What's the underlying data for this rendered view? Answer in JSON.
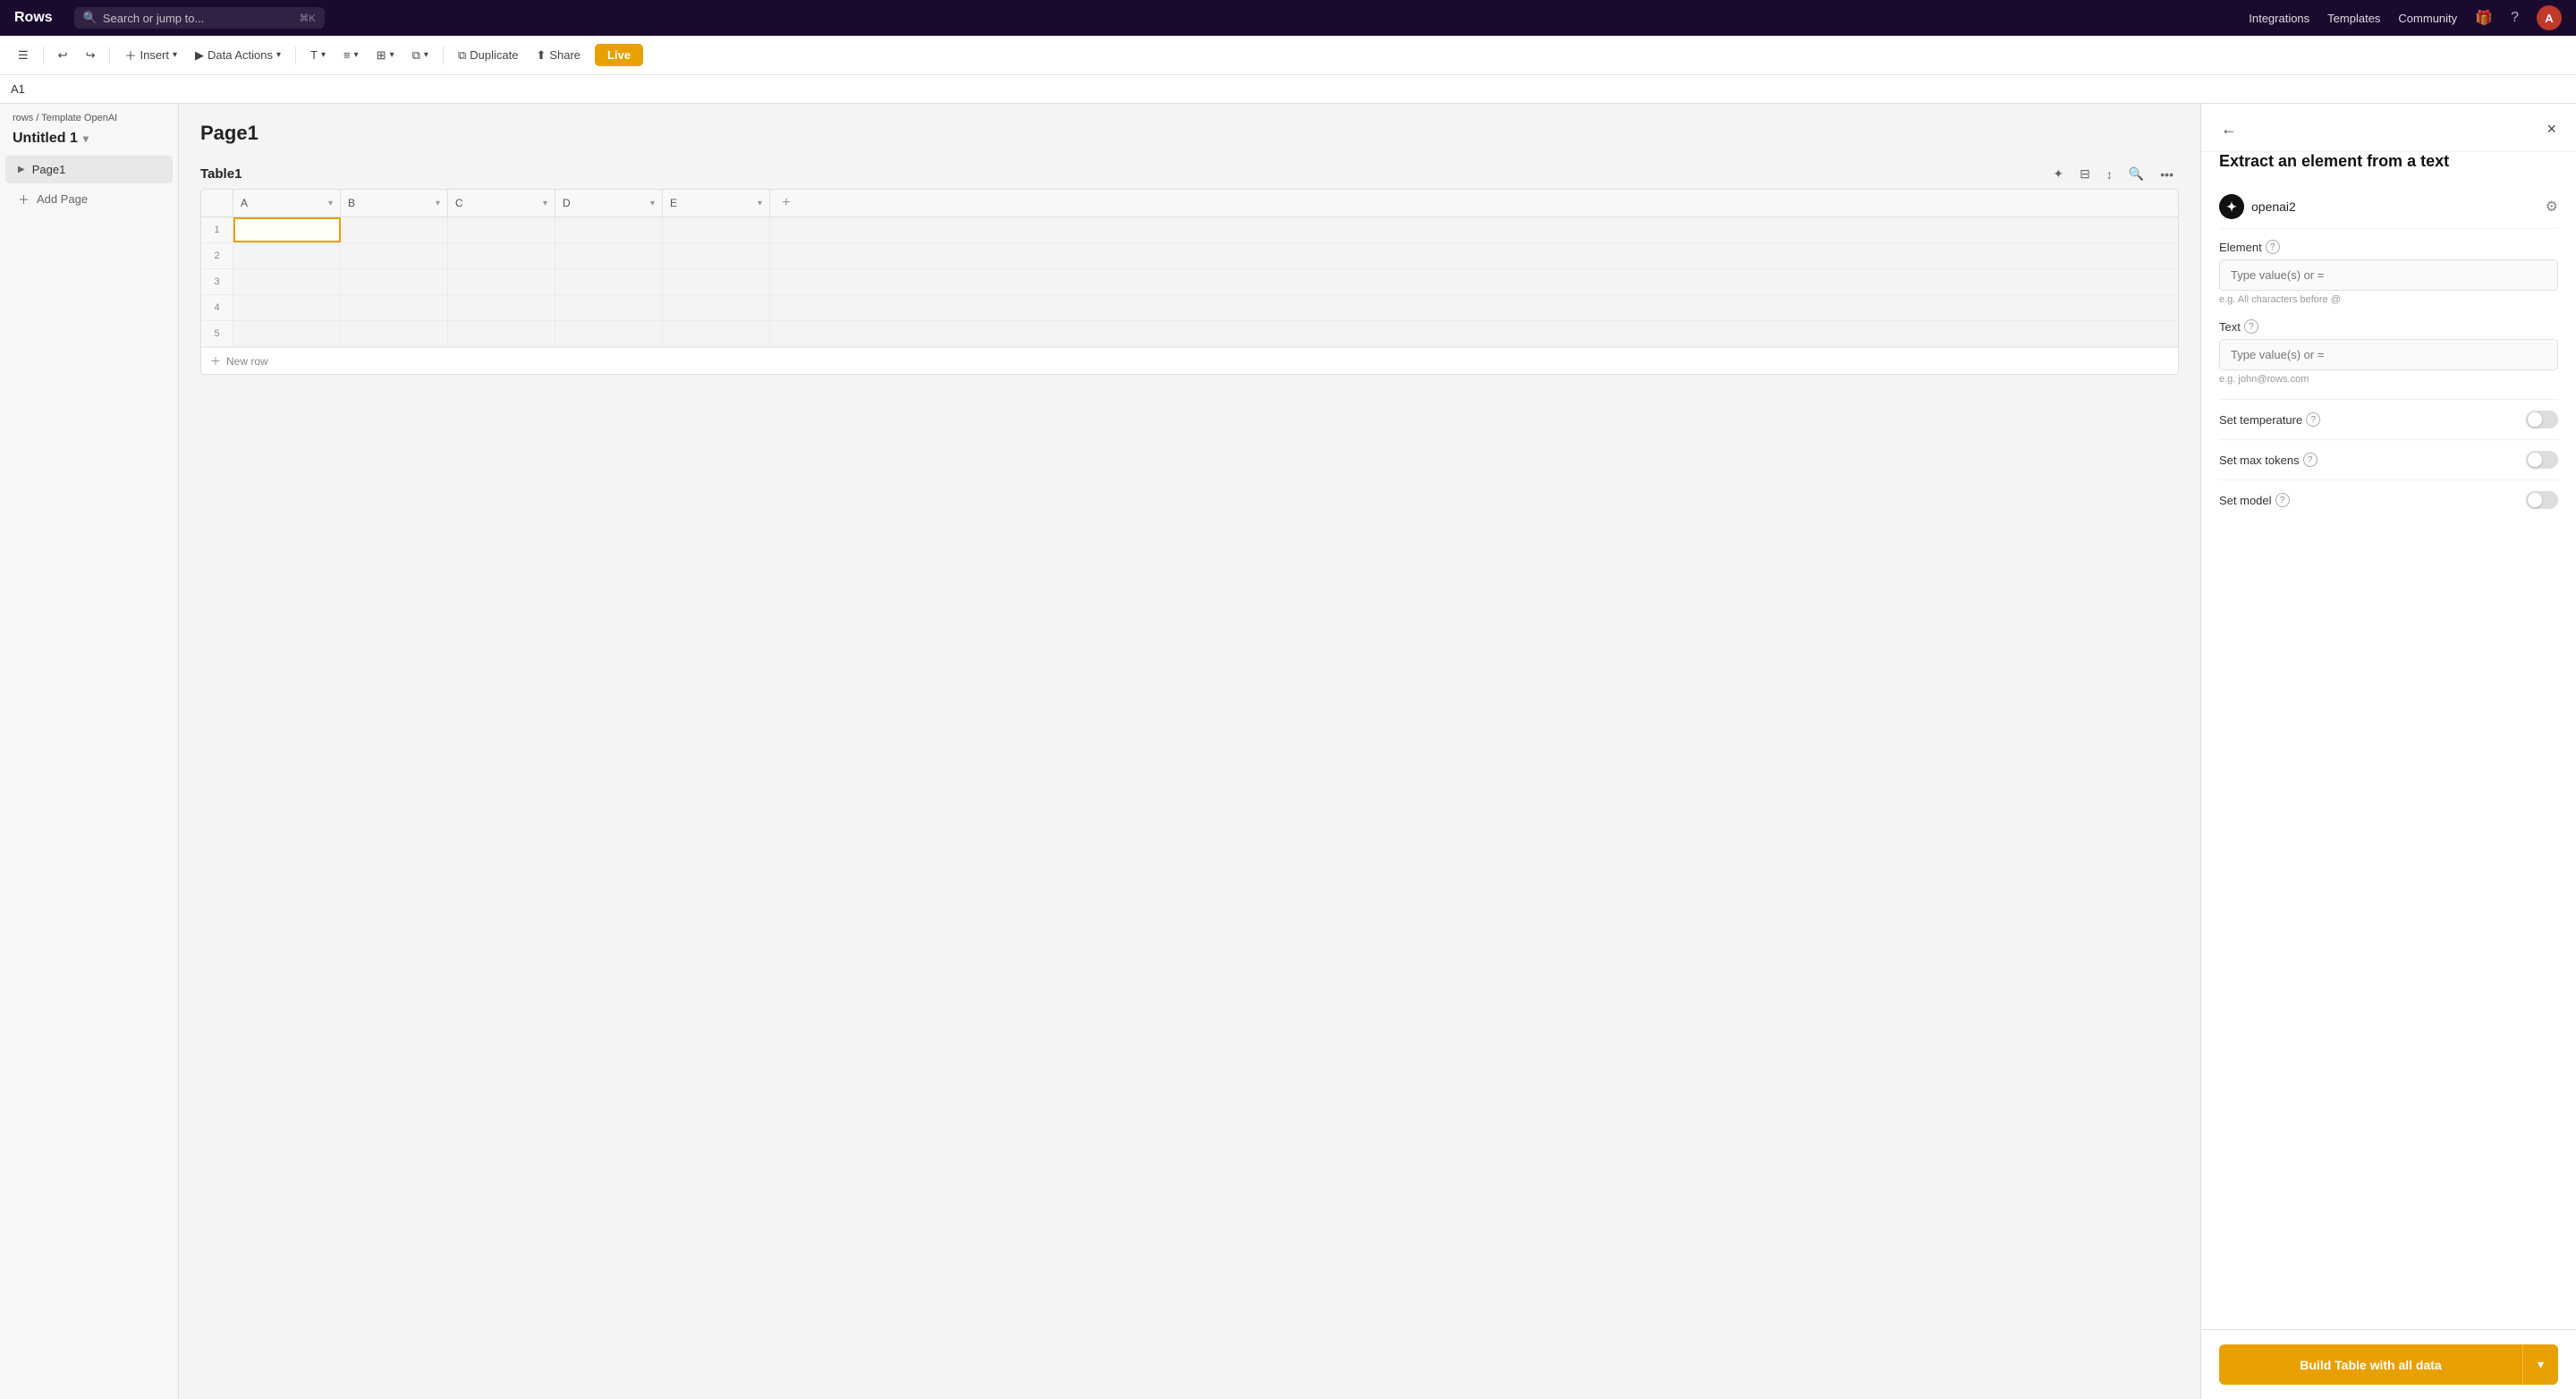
{
  "app": {
    "logo": "Rows",
    "search_placeholder": "Search or jump to...",
    "search_shortcut": "⌘K"
  },
  "topnav": {
    "links": [
      "Integrations",
      "Templates",
      "Community"
    ],
    "avatar_label": "A",
    "gift_icon": "🎁",
    "help_icon": "?",
    "search_icon": "🔍"
  },
  "toolbar": {
    "panel_toggle": "☰",
    "undo": "↩",
    "redo": "↪",
    "insert": "Insert",
    "data_actions": "Data Actions",
    "text_format": "T",
    "align": "≡",
    "cell_type": "⊞",
    "table_opts": "⧉",
    "duplicate": "Duplicate",
    "share": "Share",
    "live": "Live"
  },
  "cellbar": {
    "ref": "A1"
  },
  "sidebar": {
    "breadcrumb_parent": "rows",
    "breadcrumb_child": "Template OpenAI",
    "doc_title": "Untitled 1",
    "pages": [
      {
        "label": "Page1",
        "active": true
      }
    ],
    "add_page": "Add Page"
  },
  "sheet": {
    "page_title": "Page1",
    "table_name": "Table1",
    "columns": [
      "A",
      "B",
      "C",
      "D",
      "E"
    ],
    "rows": [
      1,
      2,
      3,
      4,
      5
    ],
    "new_row": "New row"
  },
  "panel": {
    "title": "Extract an element from a text",
    "provider_name": "openai2",
    "provider_icon": "✦",
    "element_label": "Element",
    "element_placeholder": "Type value(s) or =",
    "element_example": "e.g. All characters before @",
    "text_label": "Text",
    "text_placeholder": "Type value(s) or =",
    "text_example": "e.g. john@rows.com",
    "set_temperature_label": "Set temperature",
    "set_max_tokens_label": "Set max tokens",
    "set_model_label": "Set model",
    "build_btn": "Build Table with all data",
    "back_icon": "←",
    "close_icon": "×",
    "settings_icon": "⚙",
    "help_icon": "?"
  }
}
